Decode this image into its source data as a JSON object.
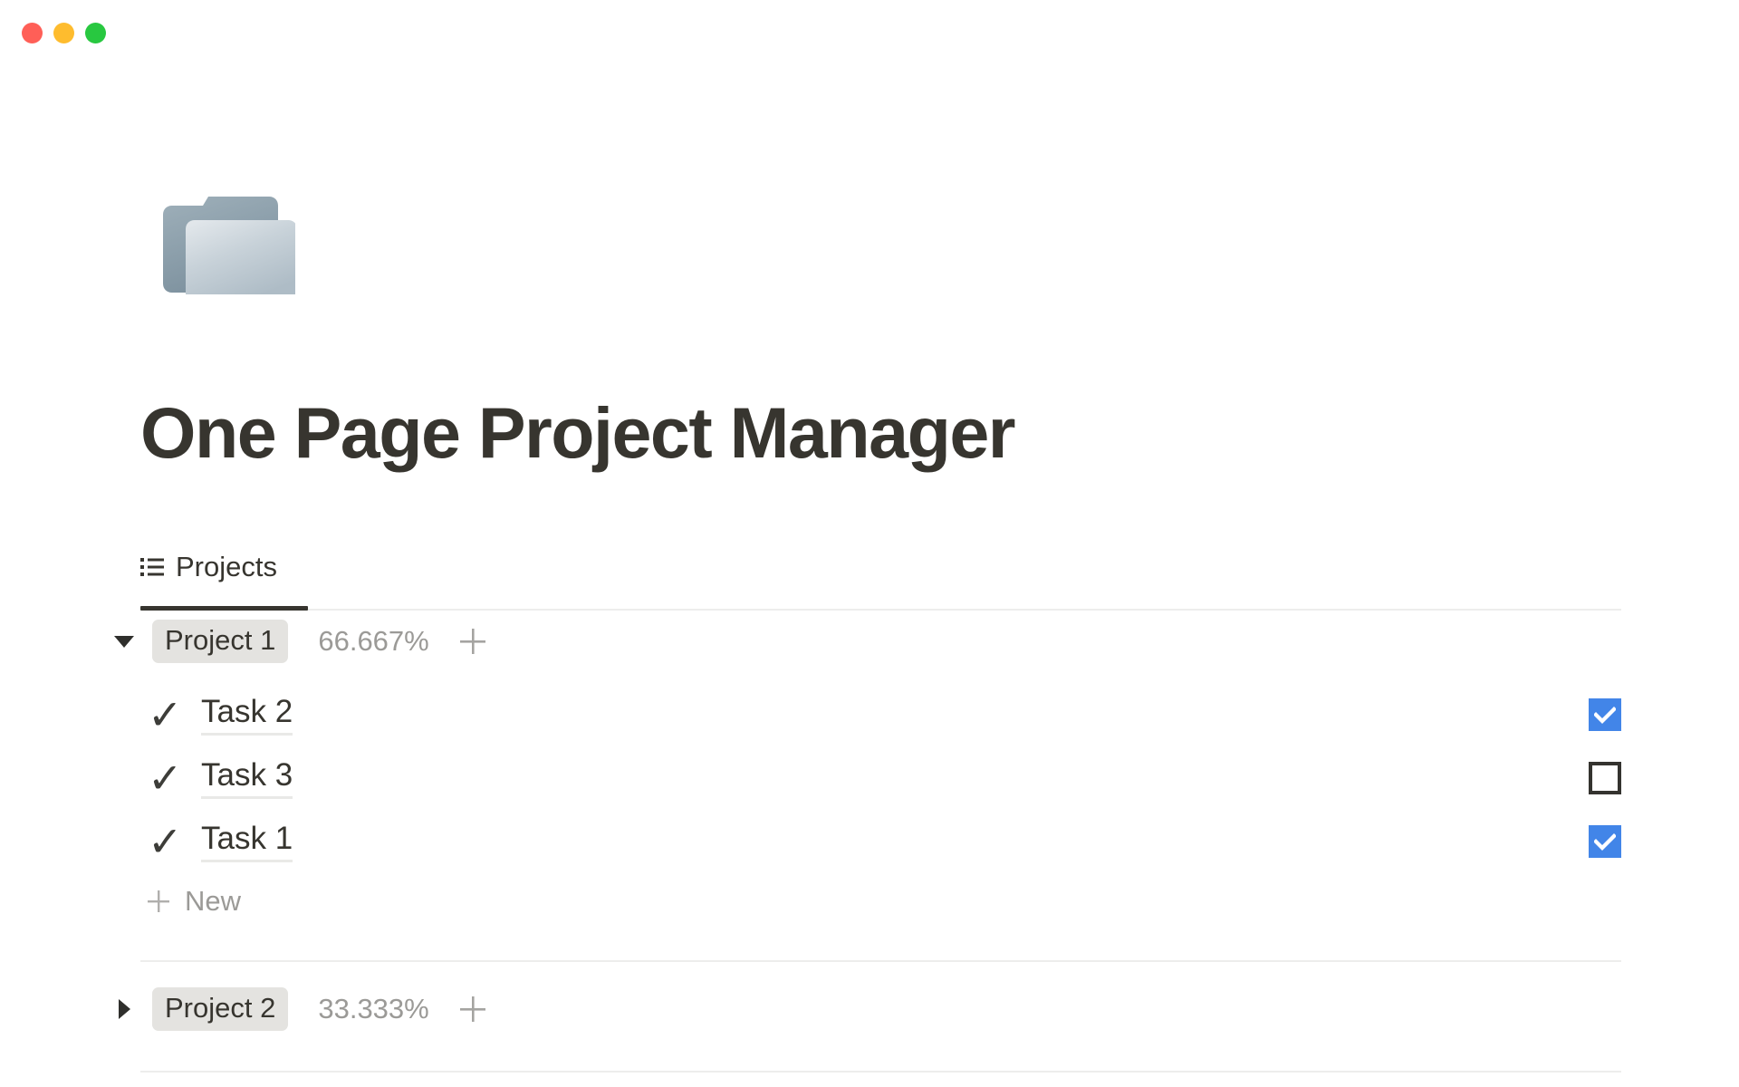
{
  "window": {
    "traffic_lights": [
      {
        "name": "close",
        "color": "#ff5f57"
      },
      {
        "name": "minimize",
        "color": "#febc2e"
      },
      {
        "name": "maximize",
        "color": "#28c840"
      }
    ]
  },
  "page": {
    "icon": "open-folder-icon",
    "title": "One Page Project Manager"
  },
  "tabs": [
    {
      "label": "Projects",
      "icon": "list-icon",
      "active": true
    }
  ],
  "colors": {
    "accent_checkbox": "#4285e8",
    "text_primary": "#37352f",
    "text_muted": "#9b9a97",
    "pill_background": "#e4e3e0",
    "divider": "#ededec"
  },
  "groups": [
    {
      "name": "Project 1",
      "percent": "66.667%",
      "expanded": true,
      "toggle_icon": "chevron-down-icon",
      "add_icon": "plus-icon",
      "tasks": [
        {
          "check_glyph": "✓",
          "name": "Task 2",
          "checked": true
        },
        {
          "check_glyph": "✓",
          "name": "Task 3",
          "checked": false
        },
        {
          "check_glyph": "✓",
          "name": "Task 1",
          "checked": true
        }
      ],
      "new_row": {
        "label": "New",
        "icon": "plus-icon"
      }
    },
    {
      "name": "Project 2",
      "percent": "33.333%",
      "expanded": false,
      "toggle_icon": "chevron-right-icon",
      "add_icon": "plus-icon",
      "tasks": [],
      "new_row": null
    }
  ]
}
